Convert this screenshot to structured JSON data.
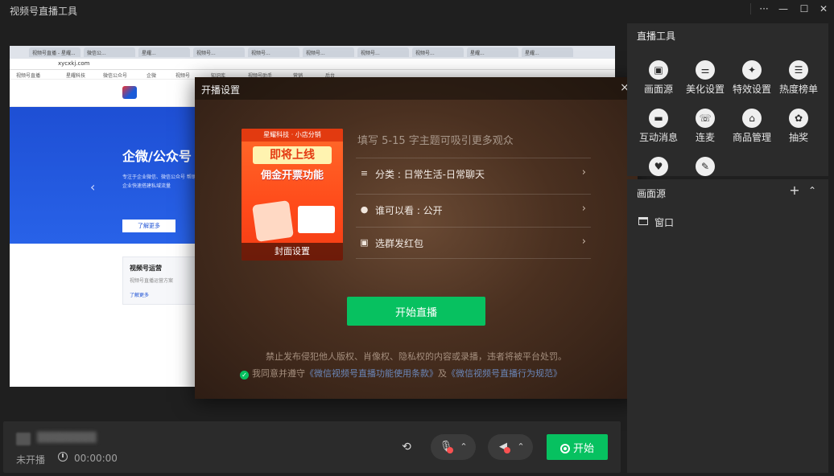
{
  "app": {
    "title": "视频号直播工具"
  },
  "window_controls": {
    "more": "···",
    "minimize": "—",
    "maximize": "☐",
    "close": "✕"
  },
  "preview": {
    "tabs": [
      "视频号直播 - 星耀...",
      "微信公...",
      "星耀...",
      "视频号...",
      "视频号...",
      "视频号...",
      "视频号...",
      "视频号...",
      "星耀...",
      "星耀..."
    ],
    "url": "xycxkj.com",
    "bookmarks": [
      "视频号直播",
      "星耀科技",
      "微信公众号",
      "企微",
      "视频号",
      "知识库",
      "视频号助手",
      "营销",
      "后台"
    ],
    "hero_title": "企微/公众号",
    "hero_sub": "专注于企业微信、微信公众号 帮助企业快速搭建私域流量",
    "hero_btn": "了解更多",
    "card_title": "视频号运营",
    "card_sub": "视频号直播运营方案",
    "card_link": "了解更多"
  },
  "dialog": {
    "title": "开播设置",
    "close": "×",
    "cover": {
      "top": "星耀科技 · 小店分销",
      "main": "即将上线",
      "main2": "佣金开票功能",
      "label": "封面设置"
    },
    "topic_placeholder": "填写 5-15 字主题可吸引更多观众",
    "rows": [
      {
        "icon": "category-icon",
        "glyph": "≡",
        "label": "分类 : 日常生活-日常聊天"
      },
      {
        "icon": "visibility-icon",
        "glyph": "●",
        "label": "谁可以看 : 公开"
      },
      {
        "icon": "red-packet-icon",
        "glyph": "▣",
        "label": "选群发红包"
      }
    ],
    "start_button": "开始直播",
    "notice": "禁止发布侵犯他人版权、肖像权、隐私权的内容或录播，违者将被平台处罚。",
    "agree_prefix": "我同意并遵守",
    "agree_link1": "《微信视频号直播功能使用条款》",
    "agree_mid": "及",
    "agree_link2": "《微信视频号直播行为规范》"
  },
  "bottombar": {
    "status": "未开播",
    "timer": "00:00:00",
    "start": "开始"
  },
  "tools": {
    "title": "直播工具",
    "items": [
      {
        "label": "画面源",
        "glyph": "▣"
      },
      {
        "label": "美化设置",
        "glyph": "⚌"
      },
      {
        "label": "特效设置",
        "glyph": "✦"
      },
      {
        "label": "热度榜单",
        "glyph": "☰"
      },
      {
        "label": "互动消息",
        "glyph": "▬"
      },
      {
        "label": "连麦",
        "glyph": "☏"
      },
      {
        "label": "商品管理",
        "glyph": "⌂"
      },
      {
        "label": "抽奖",
        "glyph": "✿"
      },
      {
        "label": "",
        "glyph": "♥"
      },
      {
        "label": "",
        "glyph": "✎"
      }
    ]
  },
  "scene": {
    "title": "画面源",
    "items": [
      {
        "label": "窗口"
      }
    ]
  },
  "colors": {
    "accent": "#07c160",
    "panel": "#2b2b2b",
    "background": "#1f1f1f"
  }
}
